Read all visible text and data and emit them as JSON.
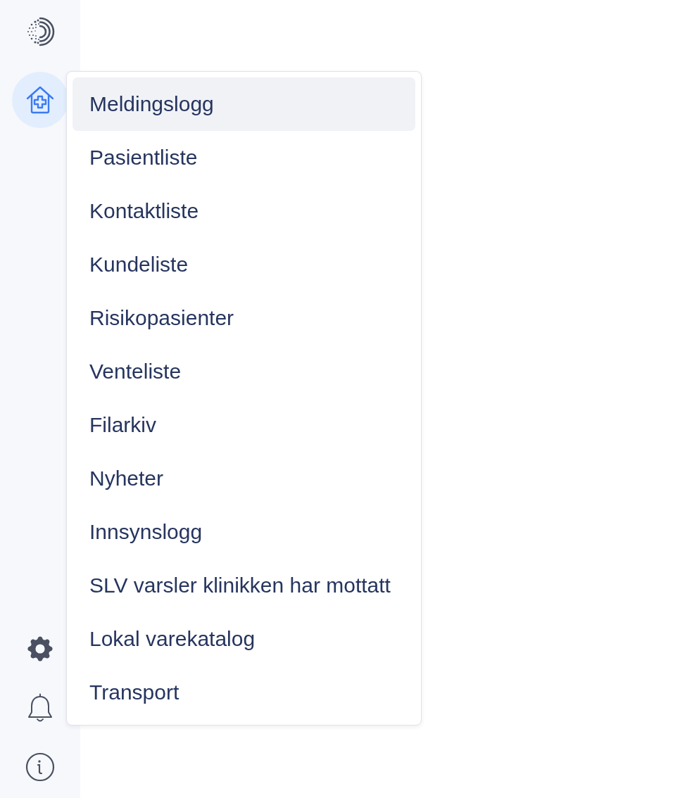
{
  "sidebar": {
    "home_button": {
      "selected": true
    }
  },
  "menu": {
    "items": [
      {
        "label": "Meldingslogg",
        "selected": true
      },
      {
        "label": "Pasientliste",
        "selected": false
      },
      {
        "label": "Kontaktliste",
        "selected": false
      },
      {
        "label": "Kundeliste",
        "selected": false
      },
      {
        "label": "Risikopasienter",
        "selected": false
      },
      {
        "label": "Venteliste",
        "selected": false
      },
      {
        "label": "Filarkiv",
        "selected": false
      },
      {
        "label": "Nyheter",
        "selected": false
      },
      {
        "label": "Innsynslogg",
        "selected": false
      },
      {
        "label": "SLV varsler klinikken har mottatt",
        "selected": false
      },
      {
        "label": "Lokal varekatalog",
        "selected": false
      },
      {
        "label": "Transport",
        "selected": false
      }
    ]
  }
}
